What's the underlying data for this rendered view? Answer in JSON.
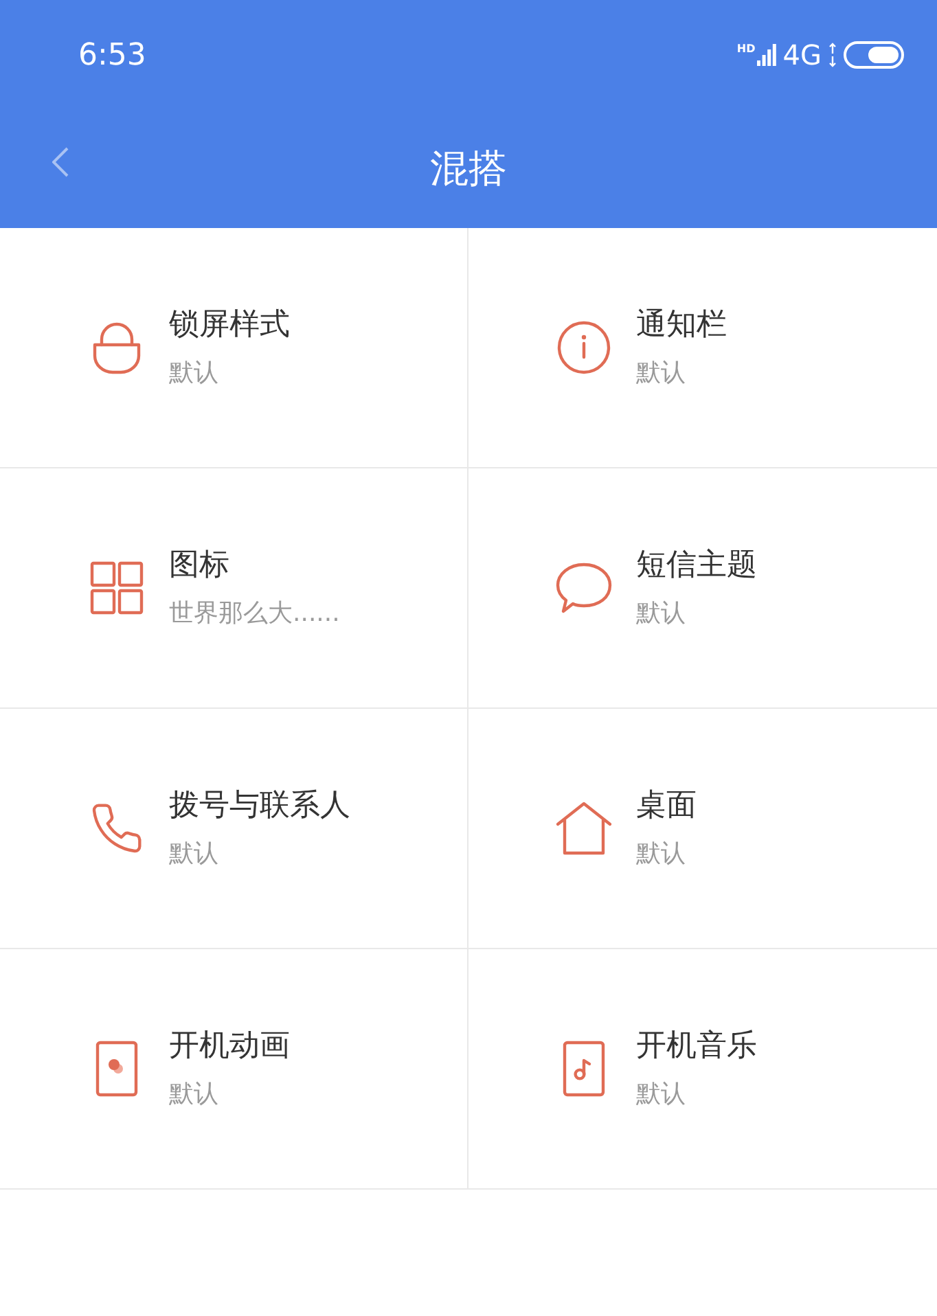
{
  "status_bar": {
    "time": "6:53",
    "signal_badge": "HD",
    "network": "4G"
  },
  "header": {
    "title": "混搭"
  },
  "items": [
    {
      "kind": "lock",
      "title": "锁屏样式",
      "subtitle": "默认"
    },
    {
      "kind": "info",
      "title": "通知栏",
      "subtitle": "默认"
    },
    {
      "kind": "grid",
      "title": "图标",
      "subtitle": "世界那么大......"
    },
    {
      "kind": "chat",
      "title": "短信主题",
      "subtitle": "默认"
    },
    {
      "kind": "phone",
      "title": "拨号与联系人",
      "subtitle": "默认"
    },
    {
      "kind": "home",
      "title": "桌面",
      "subtitle": "默认"
    },
    {
      "kind": "video",
      "title": "开机动画",
      "subtitle": "默认"
    },
    {
      "kind": "music",
      "title": "开机音乐",
      "subtitle": "默认"
    }
  ]
}
